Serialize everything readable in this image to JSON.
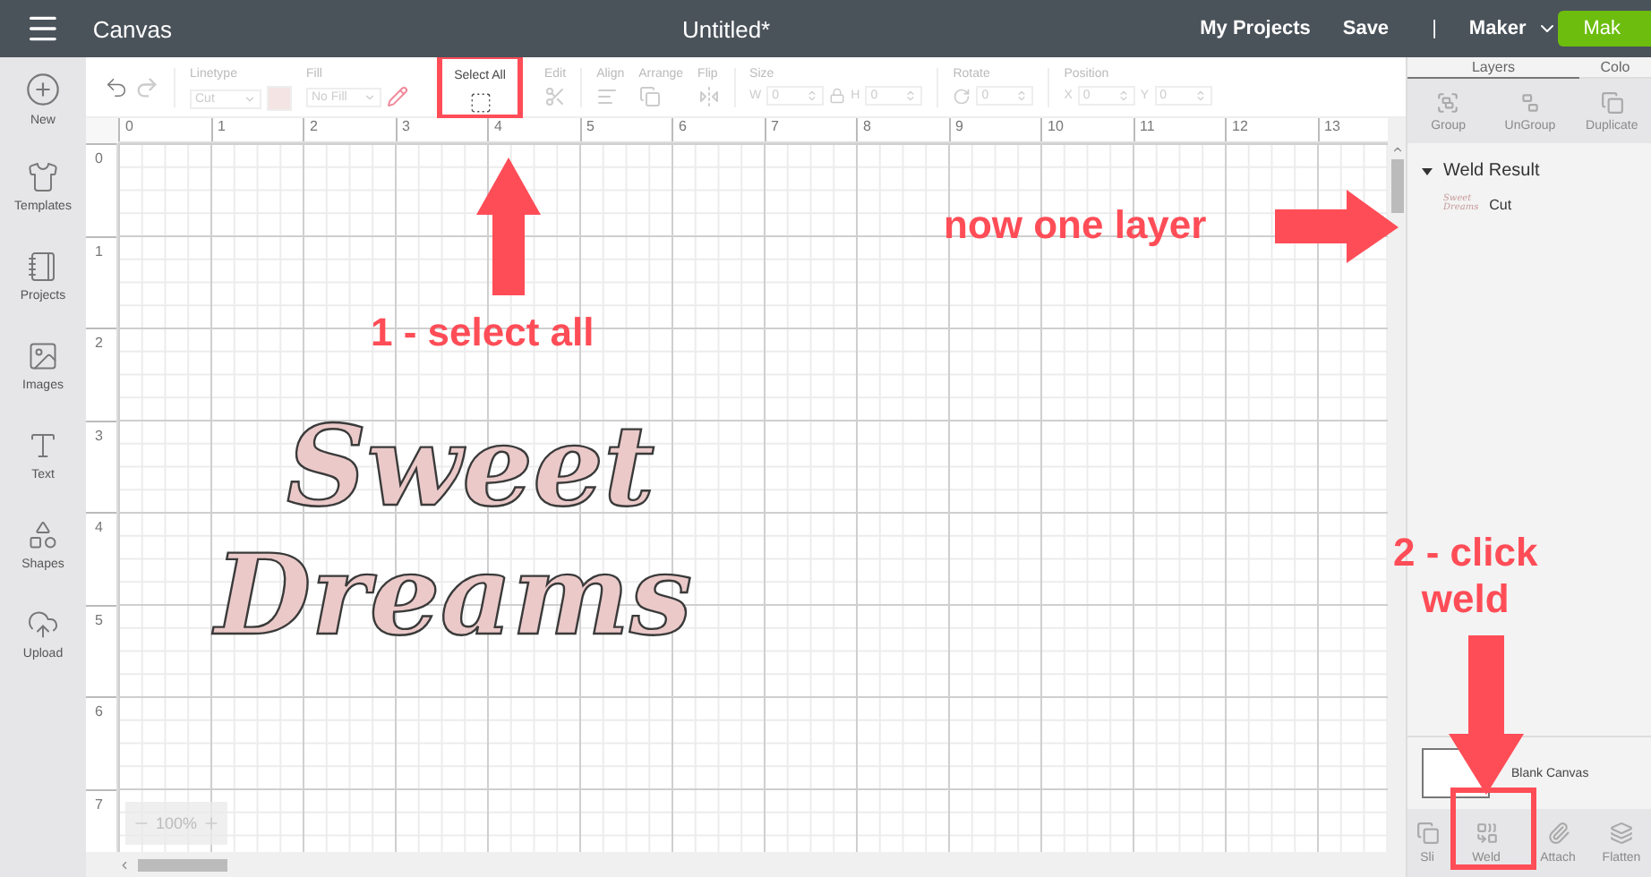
{
  "top_bar": {
    "title": "Canvas",
    "document": "Untitled*",
    "links": [
      "My Projects",
      "Save"
    ],
    "separator": "|",
    "machine": "Maker",
    "make_button": "Mak"
  },
  "sidebar": {
    "items": [
      {
        "kind": "new",
        "label": "New"
      },
      {
        "kind": "templates",
        "label": "Templates"
      },
      {
        "kind": "projects",
        "label": "Projects"
      },
      {
        "kind": "images",
        "label": "Images"
      },
      {
        "kind": "text",
        "label": "Text"
      },
      {
        "kind": "shapes",
        "label": "Shapes"
      },
      {
        "kind": "upload",
        "label": "Upload"
      }
    ]
  },
  "toolbar": {
    "linetype": {
      "label": "Linetype",
      "value": "Cut"
    },
    "fill": {
      "label": "Fill",
      "value": "No Fill"
    },
    "select_all": "Select All",
    "edit": "Edit",
    "align": "Align",
    "arrange": "Arrange",
    "flip": "Flip",
    "size": {
      "label": "Size",
      "w_label": "W",
      "w_value": "0",
      "h_label": "H",
      "h_value": "0"
    },
    "rotate": {
      "label": "Rotate",
      "value": "0"
    },
    "position": {
      "label": "Position",
      "x_label": "X",
      "x_value": "0",
      "y_label": "Y",
      "y_value": "0"
    }
  },
  "ruler": {
    "x_ticks": [
      "0",
      "1",
      "2",
      "3",
      "4",
      "5",
      "6",
      "7",
      "8",
      "9",
      "10",
      "11",
      "12",
      "13"
    ],
    "y_ticks": [
      "0",
      "1",
      "2",
      "3",
      "4",
      "5",
      "6",
      "7"
    ]
  },
  "canvas": {
    "artwork": [
      "Sweet",
      "Dreams"
    ],
    "zoom": "100%"
  },
  "layers_panel": {
    "tabs": [
      {
        "label": "Layers",
        "selected": true
      },
      {
        "label": "Colo",
        "selected": false
      }
    ],
    "actions": [
      "Group",
      "UnGroup",
      "Duplicate"
    ],
    "group": {
      "name": "Weld Result",
      "expanded": true,
      "layers": [
        {
          "thumbnail": [
            "Sweet",
            "Dreams"
          ],
          "operation": "Cut"
        }
      ]
    },
    "blank_canvas": "Blank Canvas",
    "bottom_actions": [
      "Sli",
      "Weld",
      "Attach",
      "Flatten"
    ]
  },
  "annotations": {
    "select_all_note": "1 - select all",
    "layer_note": "now one layer",
    "weld_note": [
      "2 - click",
      "weld"
    ]
  }
}
